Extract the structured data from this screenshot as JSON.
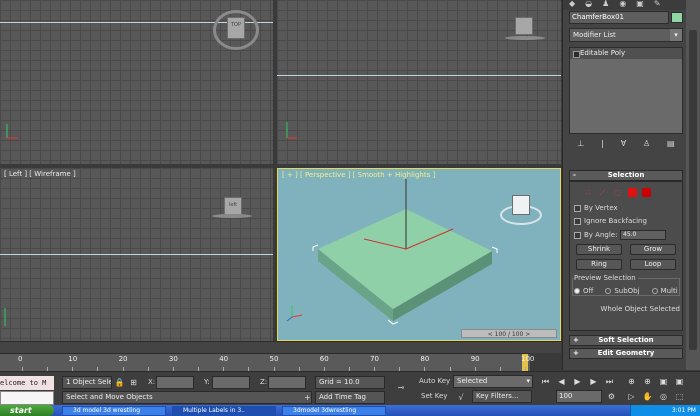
{
  "viewports": {
    "top": {
      "label": ""
    },
    "front": {
      "label": ""
    },
    "left": {
      "label": "[ Left ] [ Wireframe ]"
    },
    "perspective": {
      "label_left": "[ + ] [ Perspective ]",
      "label_right": "[ Smooth + Highlights ]",
      "frame_counter": "< 100 / 100 >"
    },
    "view_cube_labels": {
      "top": "TOP",
      "left": "left"
    }
  },
  "command_panel": {
    "object_name": "ChamferBox01",
    "object_color": "#8fd6a4",
    "modifier_list": "Modifier List",
    "stack_items": [
      "Editable Poly"
    ],
    "rollouts": {
      "selection": "Selection",
      "by_vertex": "By Vertex",
      "ignore_backfacing": "Ignore Backfacing",
      "by_angle": "By Angle:",
      "angle_value": "45.0",
      "shrink": "Shrink",
      "grow": "Grow",
      "ring": "Ring",
      "loop": "Loop",
      "preview_selection": "Preview Selection",
      "off": "Off",
      "subobj": "SubObj",
      "multi": "Multi",
      "whole_object_selected": "Whole Object Selected",
      "soft_selection": "Soft Selection",
      "edit_geometry": "Edit Geometry"
    }
  },
  "timeline": {
    "ticks": [
      "0",
      "10",
      "20",
      "30",
      "40",
      "50",
      "60",
      "70",
      "80",
      "90",
      "100"
    ]
  },
  "status_bar": {
    "maxscript_text": "elcome to M",
    "selection_count": "1 Object Sele",
    "prompt": "Select and Move Objects",
    "x_label": "X:",
    "y_label": "Y:",
    "z_label": "Z:",
    "grid": "Grid = 10.0",
    "add_time_tag": "Add Time Tag",
    "auto_key": "Auto Key",
    "set_key": "Set Key",
    "key_mode": "Selected",
    "key_filters": "Key Filters...",
    "frame_value": "100"
  },
  "taskbar": {
    "start": "start",
    "items": [
      "3d model 3d wrestling",
      "Multiple Labels in 3..",
      "3dmodel 3dwrestling"
    ],
    "clock": "3:01 PM"
  }
}
